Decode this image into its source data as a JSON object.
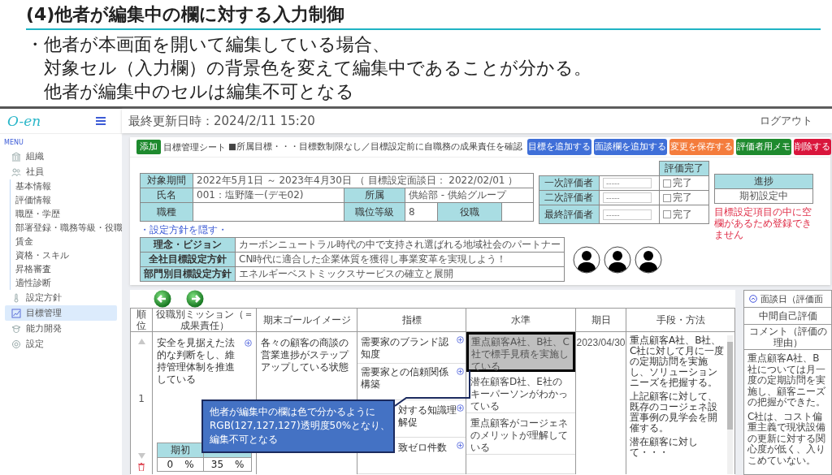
{
  "slide": {
    "title": "(4)他者が編集中の欄に対する入力制御",
    "bullet": {
      "mark": "・",
      "lines": [
        "他者が本画面を開いて編集している場合、",
        "対象セル（入力欄）の背景色を変えて編集中であることが分かる。",
        "他者が編集中のセルは編集不可となる"
      ]
    }
  },
  "sidebar": {
    "logo": "O-en",
    "menu_label": "MENU",
    "items": [
      {
        "label": "組織",
        "selected": false
      },
      {
        "label": "社員",
        "selected": false,
        "children": [
          {
            "label": "基本情報",
            "selected": false
          },
          {
            "label": "評価情報",
            "selected": false
          },
          {
            "label": "職歴・学歴",
            "selected": false
          },
          {
            "label": "部署登録・職務等級・役職",
            "selected": false
          },
          {
            "label": "賃金",
            "selected": false
          },
          {
            "label": "資格・スキル",
            "selected": false
          },
          {
            "label": "昇格審査",
            "selected": false
          },
          {
            "label": "適性診断",
            "selected": false
          }
        ]
      },
      {
        "label": "設定方針",
        "selected": false
      },
      {
        "label": "目標管理",
        "selected": true
      },
      {
        "label": "能力開発",
        "selected": false
      },
      {
        "label": "設定",
        "selected": false
      }
    ]
  },
  "topbar": {
    "last_updated": "最終更新日時：2024/2/11 15:20",
    "logout": "ログアウト"
  },
  "sheet": {
    "tag": "添加",
    "title": "目標管理シート",
    "note": "■所属目標・・・目標数制限なし／目標設定前に自職務の成果責任を確認",
    "buttons": [
      {
        "label": "目標を追加する",
        "color": "#3f6fd8"
      },
      {
        "label": "面談欄を追加する",
        "color": "#3f6fd8"
      },
      {
        "label": "変更を保存する",
        "color": "#f47c3c"
      },
      {
        "label": "評価者用メモ",
        "color": "#1e8a2e"
      },
      {
        "label": "削除する",
        "color": "#d9163c"
      }
    ],
    "info": {
      "period_label": "対象期間",
      "period": "2022年5月1日 ～ 2023年4月30日 （ 目標設定面談日： 2022/02/01 ）",
      "name_label": "氏名",
      "name": "001：塩野隆一(デモ02)",
      "dept_label": "所属",
      "dept": "供給部 - 供給グループ",
      "job_label": "職種",
      "grade_label": "職位等級",
      "grade": "8",
      "post_label": "役職"
    },
    "toggle_link": "・設定方針を隠す・",
    "policies": [
      {
        "label": "理念・ビジョン",
        "value": "カーボンニュートラル時代の中で支持され選ばれる地域社会のパートナー"
      },
      {
        "label": "全社目標設定方針",
        "value": "CN時代に適合した企業体質を獲得し事業変革を実現しよう！"
      },
      {
        "label": "部門別目標設定方針",
        "value": "エネルギーベストミックスサービスの確立と展開"
      }
    ],
    "evaluators": {
      "header": "評価完了",
      "rows": [
        {
          "role": "一次評価者",
          "placeholder": "-----",
          "done_label": "完了",
          "checked": false
        },
        {
          "role": "二次評価者",
          "placeholder": "-----",
          "done_label": "完了",
          "checked": false
        },
        {
          "role": "最終評価者",
          "placeholder": "-----",
          "done_label": "完了",
          "checked": false
        }
      ]
    },
    "progress": {
      "label": "進捗",
      "value": "期初設定中"
    },
    "error": "目標設定項目の中に空欄があるため登録できません"
  },
  "goals": {
    "columns": [
      "順位",
      "役職別ミッション（＝成果責任）",
      "期末ゴールイメージ",
      "指標",
      "水準",
      "期日",
      "手段・方法"
    ],
    "row": {
      "rank": "1",
      "mission": "安全を見据えた法的な判断をし、維持管理体制を推進している",
      "ratio": {
        "header": "期初",
        "cells": [
          {
            "value": "0",
            "unit": "%"
          },
          {
            "value": "35",
            "unit": "%"
          }
        ]
      },
      "goal": "各々の顧客の商談の営業進捗がステップアップしている状態",
      "indicators": [
        "需要家のブランド認知度",
        "需要家との信頼関係構築",
        "対する知識理解促",
        "致ゼロ件数"
      ],
      "levels": [
        {
          "text": "重点顧客A社、B社、C社で標手見積を実施している",
          "locked": true
        },
        {
          "text": "潜在顧客D社、E社のキーパーソンがわかっている",
          "locked": false
        },
        {
          "text": "重点顧客がコージェネのメリットが理解している",
          "locked": false
        },
        {
          "locked": false
        }
      ],
      "date": "2023/04/30",
      "method": [
        "重点顧客A社、B社、C社に対して月に一度の定期訪問を実施し、ソリューションニーズを把握する。",
        "上記顧客に対して、既存のコージェネ設置事例の見学会を開催する。",
        "潜在顧客に対して・・・"
      ]
    }
  },
  "review": {
    "header": "面談日（評価面",
    "subheader": "中間自己評価",
    "comment_header": "コメント（評価の理由）",
    "comment": [
      "重点顧客A社、B社については月一度の定期訪問を実施し、顧客ニーズの把握ができた。",
      "C社は、コスト偏重主義で現状設備の更新に対する関心度が低く、入りこめていない。"
    ]
  },
  "callout": {
    "lines": [
      "他者が編集中の欄は色で分かるように",
      "RGB(127,127,127)透明度50%となり、",
      "編集不可となる"
    ]
  }
}
